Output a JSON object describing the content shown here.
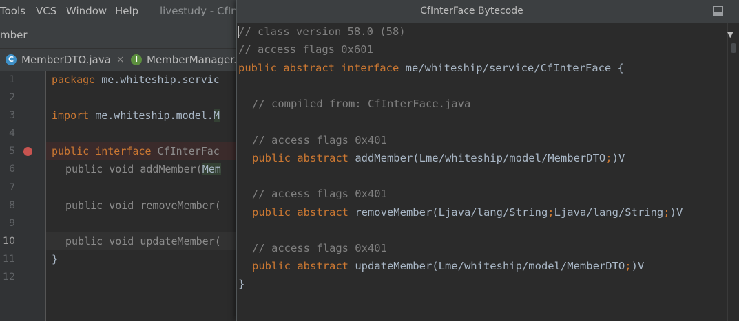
{
  "menu": {
    "items": [
      "Tools",
      "VCS",
      "Window",
      "Help"
    ],
    "title": "livestudy - CfInte"
  },
  "nav": {
    "crumb": "mber"
  },
  "tabs": [
    {
      "label": "MemberDTO.java",
      "icon": "C",
      "close": "×"
    },
    {
      "label": "MemberManager.ja",
      "icon": "I"
    }
  ],
  "editor": {
    "line_numbers": [
      "1",
      "2",
      "3",
      "4",
      "5",
      "6",
      "7",
      "8",
      "9",
      "10",
      "11",
      "12"
    ],
    "lines": {
      "l1_kw": "package",
      "l1_rest": " me.whiteship.servic",
      "l3_kw": "import",
      "l3_rest": " me.whiteship.model.",
      "l3_badge": "M",
      "l5_kw1": "public",
      "l5_kw2": "interface",
      "l5_rest": "CfInterFac",
      "l6_text": "public void addMember(",
      "l6_badge": "Mem",
      "l8_text": "public void removeMember(",
      "l10_text": "public void updateMember(",
      "l10_paren": "(",
      "l11_text": "}"
    }
  },
  "popup": {
    "title": "CfInterFace Bytecode",
    "lines": {
      "b1": "// class version 58.0 (58)",
      "b2": "// access flags 0x601",
      "b3_kw": "public abstract interface",
      "b3_rest": " me/whiteship/service/CfInterFace {",
      "b5": "// compiled from: CfInterFace.java",
      "b7": "// access flags 0x401",
      "b8_kw": "public abstract",
      "b8_rest": " addMember(Lme/whiteship/model/MemberDTO",
      "b8_semi": ";",
      "b8_end": ")V",
      "b10": "// access flags 0x401",
      "b11_kw": "public abstract",
      "b11_rest1": " removeMember(Ljava/lang/String",
      "b11_semi1": ";",
      "b11_rest2": "Ljava/lang/String",
      "b11_semi2": ";",
      "b11_end": ")V",
      "b13": "// access flags 0x401",
      "b14_kw": "public abstract",
      "b14_rest": " updateMember(Lme/whiteship/model/MemberDTO",
      "b14_semi": ";",
      "b14_end": ")V",
      "b15": "}"
    }
  },
  "colors": {
    "keyword": "#cc7832",
    "comment": "#808080",
    "text": "#a9b7c6",
    "background": "#2b2b2b",
    "breakpoint": "#c75450",
    "class_icon": "#3d8fc6",
    "interface_icon": "#5c8f3e"
  }
}
